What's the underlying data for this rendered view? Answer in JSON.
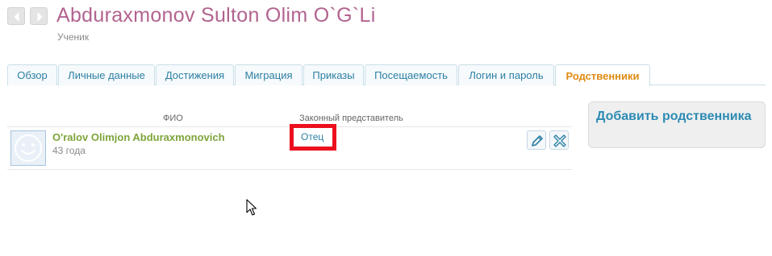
{
  "header": {
    "title": "Abduraxmonov Sulton Olim O`G`Li",
    "subtitle": "Ученик"
  },
  "tabs": [
    {
      "label": "Обзор",
      "active": false
    },
    {
      "label": "Личные данные",
      "active": false
    },
    {
      "label": "Достижения",
      "active": false
    },
    {
      "label": "Миграция",
      "active": false
    },
    {
      "label": "Приказы",
      "active": false
    },
    {
      "label": "Посещаемость",
      "active": false
    },
    {
      "label": "Логин и пароль",
      "active": false
    },
    {
      "label": "Родственники",
      "active": true
    }
  ],
  "table": {
    "headers": {
      "name": "ФИО",
      "guardian": "Законный представитель"
    },
    "rows": [
      {
        "name": "O'ralov Olimjon Abduraxmonovich",
        "age": "43 года",
        "relation": "Отец"
      }
    ]
  },
  "sidebar": {
    "add_button": "Добавить родственника"
  },
  "colors": {
    "title": "#b2638f",
    "active_tab": "#de8b13",
    "link": "#2c7fa4",
    "name": "#7ea43a",
    "highlight": "#ec0f1e"
  },
  "icons": {
    "back": "chevron-left-icon",
    "forward": "chevron-right-icon",
    "avatar": "smiley-face-icon",
    "edit": "pencil-icon",
    "delete": "close-icon",
    "cursor": "mouse-pointer-icon"
  }
}
